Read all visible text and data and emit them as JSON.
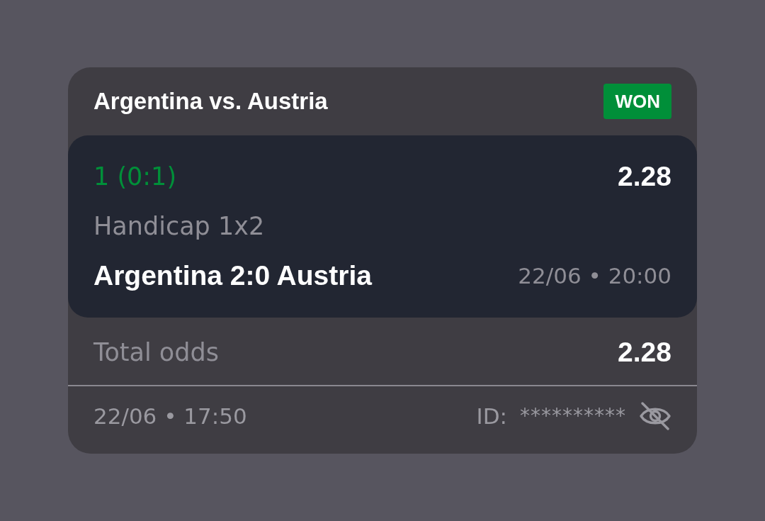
{
  "bet": {
    "title": "Argentina vs. Austria",
    "status": {
      "label": "WON",
      "kind": "won"
    }
  },
  "selection": {
    "pick": "1 (0:1)",
    "odds": "2.28",
    "market": "Handicap 1x2",
    "match": "Argentina 2:0 Austria",
    "match_time": "22/06 • 20:00"
  },
  "total": {
    "label": "Total odds",
    "value": "2.28"
  },
  "footer": {
    "placed_time": "22/06 • 17:50",
    "id_label": "ID:",
    "id_value": "**********",
    "id_hidden": true
  }
}
